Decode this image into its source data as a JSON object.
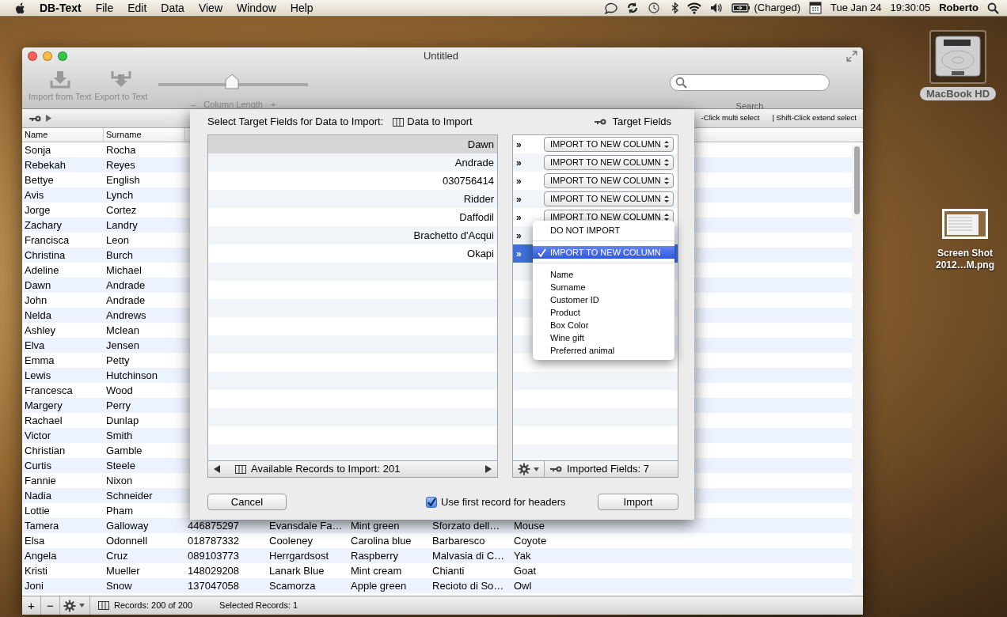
{
  "menu_bar": {
    "items": [
      {
        "label": "DB-Text",
        "kind": "app"
      },
      {
        "label": "File",
        "kind": "menu"
      },
      {
        "label": "Edit",
        "kind": "menu"
      },
      {
        "label": "Data",
        "kind": "menu"
      },
      {
        "label": "View",
        "kind": "menu"
      },
      {
        "label": "Window",
        "kind": "menu"
      },
      {
        "label": "Help",
        "kind": "menu"
      }
    ],
    "status": {
      "battery": "(Charged)",
      "date": "Tue Jan 24",
      "time": "19:30:05",
      "user": "Roberto"
    }
  },
  "desktop_icons": [
    {
      "kind": "drive",
      "lines": [
        "MacBook HD"
      ],
      "selected": true
    },
    {
      "kind": "screenshot",
      "lines": [
        "Screen Shot",
        "2012…M.png"
      ],
      "selected": false
    }
  ],
  "window": {
    "title": "Untitled"
  },
  "toolbar": {
    "buttons": [
      {
        "kind": "import",
        "label": "Import from Text"
      },
      {
        "kind": "export",
        "label": "Export to Text"
      }
    ],
    "slider": {
      "minus": "–",
      "label": "Column Length",
      "plus": "+",
      "level": 0.49
    },
    "search": {
      "label": "Search"
    }
  },
  "selection_hints": [
    "-Click multi select",
    "| Shift-Click extend select"
  ],
  "table": {
    "columns": [
      "Name",
      "Surname"
    ],
    "rows": [
      {
        "cells": [
          "Sonja",
          "Rocha"
        ]
      },
      {
        "cells": [
          "Rebekah",
          "Reyes"
        ]
      },
      {
        "cells": [
          "Bettye",
          "English"
        ]
      },
      {
        "cells": [
          "Avis",
          "Lynch"
        ]
      },
      {
        "cells": [
          "Jorge",
          "Cortez"
        ]
      },
      {
        "cells": [
          "Zachary",
          "Landry"
        ]
      },
      {
        "cells": [
          "Francisca",
          "Leon"
        ]
      },
      {
        "cells": [
          "Christina",
          "Burch"
        ]
      },
      {
        "cells": [
          "Adeline",
          "Michael"
        ]
      },
      {
        "cells": [
          "Dawn",
          "Andrade"
        ]
      },
      {
        "cells": [
          "John",
          "Andrade"
        ]
      },
      {
        "cells": [
          "Nelda",
          "Andrews"
        ]
      },
      {
        "cells": [
          "Ashley",
          "Mclean"
        ]
      },
      {
        "cells": [
          "Elva",
          "Jensen"
        ]
      },
      {
        "cells": [
          "Emma",
          "Petty"
        ]
      },
      {
        "cells": [
          "Lewis",
          "Hutchinson"
        ]
      },
      {
        "cells": [
          "Francesca",
          "Wood"
        ]
      },
      {
        "cells": [
          "Margery",
          "Perry"
        ]
      },
      {
        "cells": [
          "Rachael",
          "Dunlap"
        ]
      },
      {
        "cells": [
          "Victor",
          "Smith"
        ]
      },
      {
        "cells": [
          "Christian",
          "Gamble"
        ]
      },
      {
        "cells": [
          "Curtis",
          "Steele"
        ]
      },
      {
        "cells": [
          "Fannie",
          "Nixon"
        ]
      },
      {
        "cells": [
          "Nadia",
          "Schneider"
        ]
      },
      {
        "cells": [
          "Lottie",
          "Pham"
        ]
      },
      {
        "cells": [
          "Tamera",
          "Galloway",
          "446875297",
          "Evansdale Fa…",
          "Mint green",
          "Sforzato dell…",
          "Mouse"
        ]
      },
      {
        "cells": [
          "Elsa",
          "Odonnell",
          "018787332",
          "Cooleney",
          "Carolina blue",
          "Barbaresco",
          "Coyote"
        ]
      },
      {
        "cells": [
          "Angela",
          "Cruz",
          "089103773",
          "Herrgardsost",
          "Raspberry",
          "Malvasia di C…",
          "Yak"
        ]
      },
      {
        "cells": [
          "Kristi",
          "Mueller",
          "148029208",
          "Lanark Blue",
          "Mint cream",
          "Chianti",
          "Goat"
        ]
      },
      {
        "cells": [
          "Joni",
          "Snow",
          "137047058",
          "Scamorza",
          "Apple green",
          "Recioto di So…",
          "Owl"
        ]
      }
    ]
  },
  "status_bar": {
    "add": "+",
    "remove": "−",
    "records": "Records: 200 of 200",
    "selected": "Selected Records: 1"
  },
  "import_sheet": {
    "title": "Select Target Fields for Data to Import:",
    "source_header": "Data to Import",
    "target_header": "Target Fields",
    "source_values": [
      {
        "text": "Dawn",
        "selected": true
      },
      {
        "text": "Andrade",
        "selected": false
      },
      {
        "text": "030756414",
        "selected": false
      },
      {
        "text": "Ridder",
        "selected": false
      },
      {
        "text": "Daffodil",
        "selected": false
      },
      {
        "text": "Brachetto d'Acqui",
        "selected": false
      },
      {
        "text": "Okapi",
        "selected": false
      }
    ],
    "target_rows": [
      {
        "marker": "»",
        "value": "IMPORT TO NEW COLUMN",
        "selected": false
      },
      {
        "marker": "»",
        "value": "IMPORT TO NEW COLUMN",
        "selected": false
      },
      {
        "marker": "»",
        "value": "IMPORT TO NEW COLUMN",
        "selected": false
      },
      {
        "marker": "»",
        "value": "IMPORT TO NEW COLUMN",
        "selected": false
      },
      {
        "marker": "»",
        "value": "IMPORT TO NEW COLUMN",
        "selected": false
      },
      {
        "marker": "»",
        "selected": false
      },
      {
        "marker": "»",
        "selected": true
      }
    ],
    "source_footer": "Available Records to Import: 201",
    "target_footer": "Imported Fields: 7",
    "cancel": "Cancel",
    "first_record": {
      "label": "Use first record for headers",
      "checked": true
    },
    "import": "Import"
  },
  "popup_menu": {
    "items": [
      {
        "kind": "item",
        "label": "DO NOT IMPORT",
        "checked": false,
        "selected": false
      },
      {
        "kind": "separator"
      },
      {
        "kind": "item",
        "label": "IMPORT TO NEW COLUMN",
        "checked": true,
        "selected": true
      },
      {
        "kind": "separator"
      },
      {
        "kind": "item",
        "label": "Name",
        "checked": false,
        "selected": false
      },
      {
        "kind": "item",
        "label": "Surname",
        "checked": false,
        "selected": false
      },
      {
        "kind": "item",
        "label": "Customer ID",
        "checked": false,
        "selected": false
      },
      {
        "kind": "item",
        "label": "Product",
        "checked": false,
        "selected": false
      },
      {
        "kind": "item",
        "label": "Box Color",
        "checked": false,
        "selected": false
      },
      {
        "kind": "item",
        "label": "Wine gift",
        "checked": false,
        "selected": false
      },
      {
        "kind": "item",
        "label": "Preferred animal",
        "checked": false,
        "selected": false
      }
    ]
  }
}
